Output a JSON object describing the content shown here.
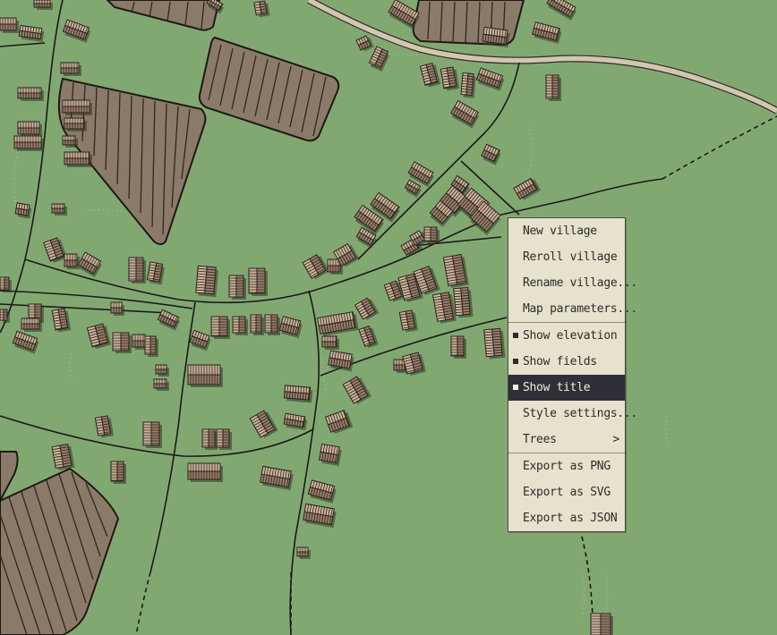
{
  "colors": {
    "grass": "#82a872",
    "field": "#8c7a69",
    "roof_light": "#cdb39a",
    "roof_dark": "#9a7d6a",
    "road_main": "#d2c7ae",
    "menu_bg": "#e6e2cd",
    "menu_highlight": "#2f2f38"
  },
  "context_menu": {
    "items": [
      {
        "label": "New village",
        "checked": false,
        "submenu": false
      },
      {
        "label": "Reroll village",
        "checked": false,
        "submenu": false
      },
      {
        "label": "Rename village...",
        "checked": false,
        "submenu": false
      },
      {
        "label": "Map parameters...",
        "checked": false,
        "submenu": false
      },
      {
        "label": "Show elevation",
        "checked": true,
        "submenu": false
      },
      {
        "label": "Show fields",
        "checked": true,
        "submenu": false
      },
      {
        "label": "Show title",
        "checked": true,
        "submenu": false,
        "highlighted": true
      },
      {
        "label": "Style settings...",
        "checked": false,
        "submenu": false
      },
      {
        "label": "Trees",
        "checked": false,
        "submenu": true,
        "submenu_indicator": ">"
      },
      {
        "label": "Export as PNG",
        "checked": false,
        "submenu": false
      },
      {
        "label": "Export as SVG",
        "checked": false,
        "submenu": false
      },
      {
        "label": "Export as JSON",
        "checked": false,
        "submenu": false
      }
    ]
  }
}
